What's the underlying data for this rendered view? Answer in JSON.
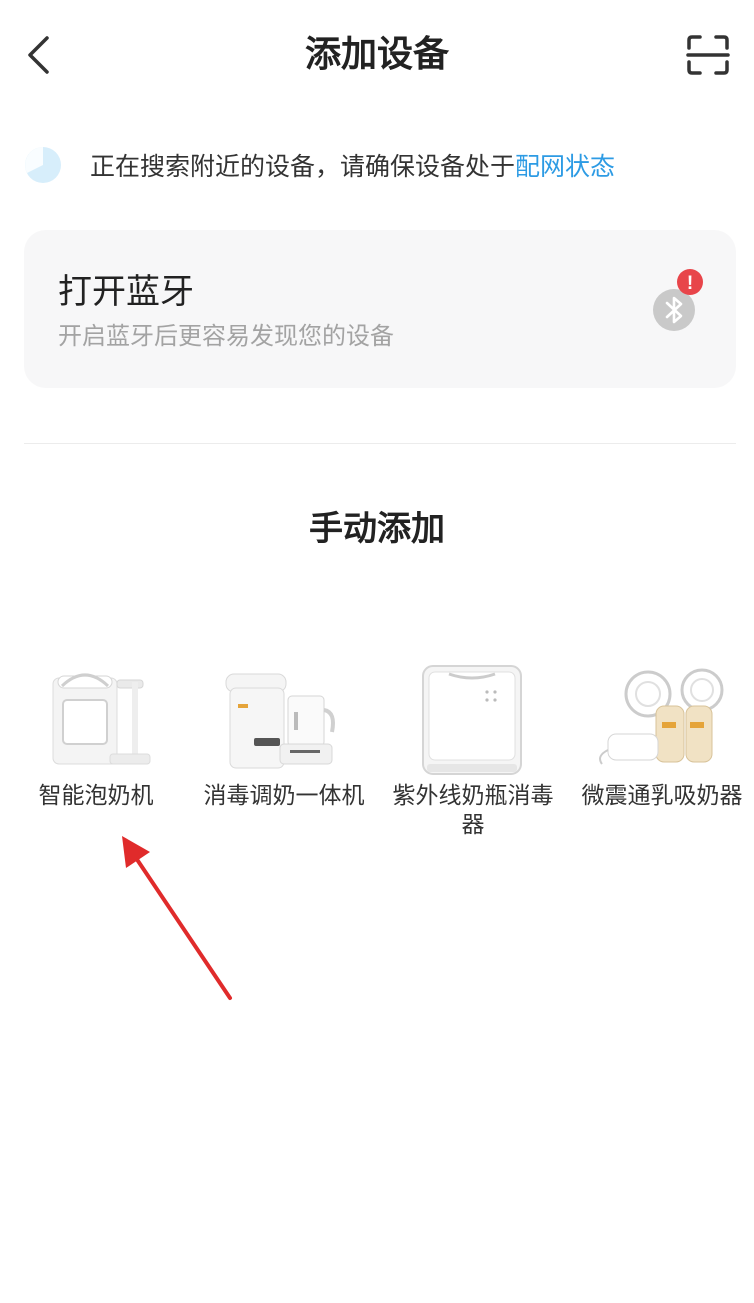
{
  "header": {
    "title": "添加设备",
    "back_icon": "chevron-left-icon",
    "scan_icon": "scan-icon"
  },
  "search": {
    "text": "正在搜索附近的设备，请确保设备处于 ",
    "link": "配网状态",
    "link_color": "#2d9be4"
  },
  "bluetooth": {
    "title": "打开蓝牙",
    "subtitle": "开启蓝牙后更容易发现您的设备",
    "icon": "bluetooth-icon",
    "badge": "!",
    "badge_color": "#e8454a"
  },
  "manual": {
    "title": "手动添加",
    "devices": [
      {
        "label": "智能泡奶机",
        "icon": "formula-dispenser-icon"
      },
      {
        "label": "消毒调奶一体机",
        "icon": "sterilizer-kettle-icon"
      },
      {
        "label": "紫外线奶瓶消毒器",
        "icon": "uv-sterilizer-icon"
      },
      {
        "label": "微震通乳吸奶器",
        "icon": "breast-pump-icon"
      }
    ]
  },
  "annotation": {
    "arrow_color": "#e02b2b"
  }
}
